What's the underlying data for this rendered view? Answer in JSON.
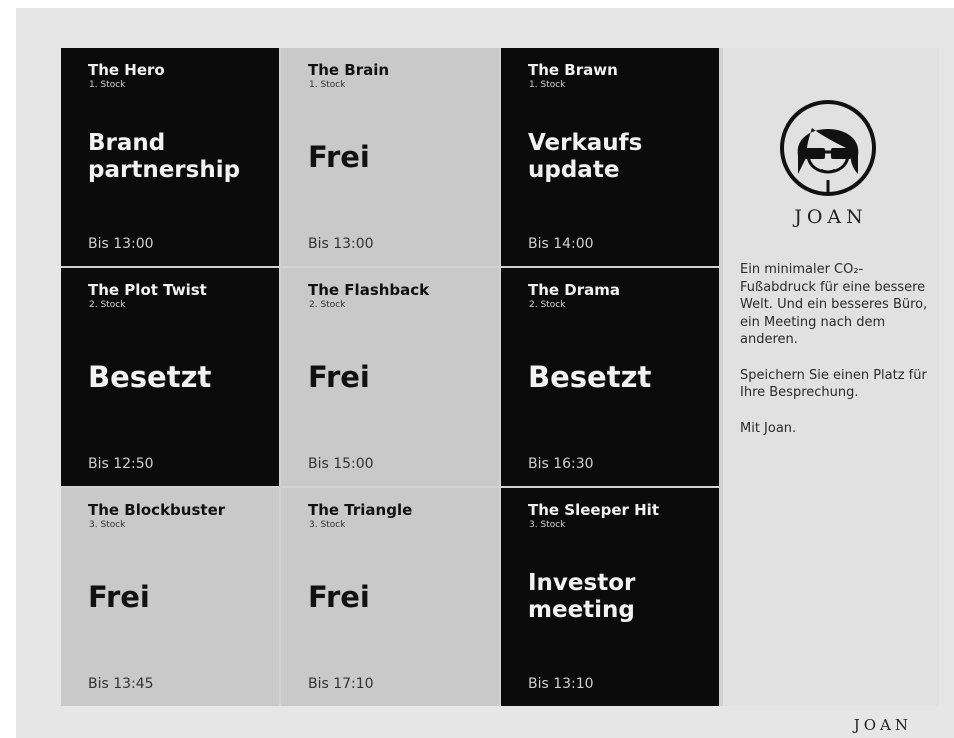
{
  "rooms": [
    {
      "name": "The Hero",
      "floor": "1. Stock",
      "status": "Brand partnership",
      "until": "Bis 13:00",
      "theme": "dark"
    },
    {
      "name": "The Brain",
      "floor": "1. Stock",
      "status": "Frei",
      "until": "Bis 13:00",
      "theme": "light"
    },
    {
      "name": "The Brawn",
      "floor": "1. Stock",
      "status": "Verkaufs update",
      "until": "Bis 14:00",
      "theme": "dark"
    },
    {
      "name": "The Plot Twist",
      "floor": "2. Stock",
      "status": "Besetzt",
      "until": "Bis 12:50",
      "theme": "dark"
    },
    {
      "name": "The Flashback",
      "floor": "2. Stock",
      "status": "Frei",
      "until": "Bis 15:00",
      "theme": "light"
    },
    {
      "name": "The Drama",
      "floor": "2. Stock",
      "status": "Besetzt",
      "until": "Bis 16:30",
      "theme": "dark"
    },
    {
      "name": "The Blockbuster",
      "floor": "3. Stock",
      "status": "Frei",
      "until": "Bis 13:45",
      "theme": "light"
    },
    {
      "name": "The Triangle",
      "floor": "3. Stock",
      "status": "Frei",
      "until": "Bis 17:10",
      "theme": "light"
    },
    {
      "name": "The Sleeper Hit",
      "floor": "3. Stock",
      "status": "Investor meeting",
      "until": "Bis 13:10",
      "theme": "dark"
    }
  ],
  "sidebar": {
    "logo_icon": "woman-with-glasses-icon",
    "brand": "JOAN",
    "paragraphs": [
      "Ein minimaler CO₂-Fußabdruck für eine bessere Welt. Und ein besseres Büro, ein Meeting nach dem anderen.",
      "Speichern Sie einen Platz für Ihre Besprechung.",
      "Mit Joan."
    ]
  },
  "device": {
    "brand": "JOAN"
  },
  "colors": {
    "occupied_bg": "#0b0b0b",
    "free_bg": "#c9c9c9",
    "sidebar_bg": "#e1e1e1",
    "bezel": "#e6e6e6"
  }
}
